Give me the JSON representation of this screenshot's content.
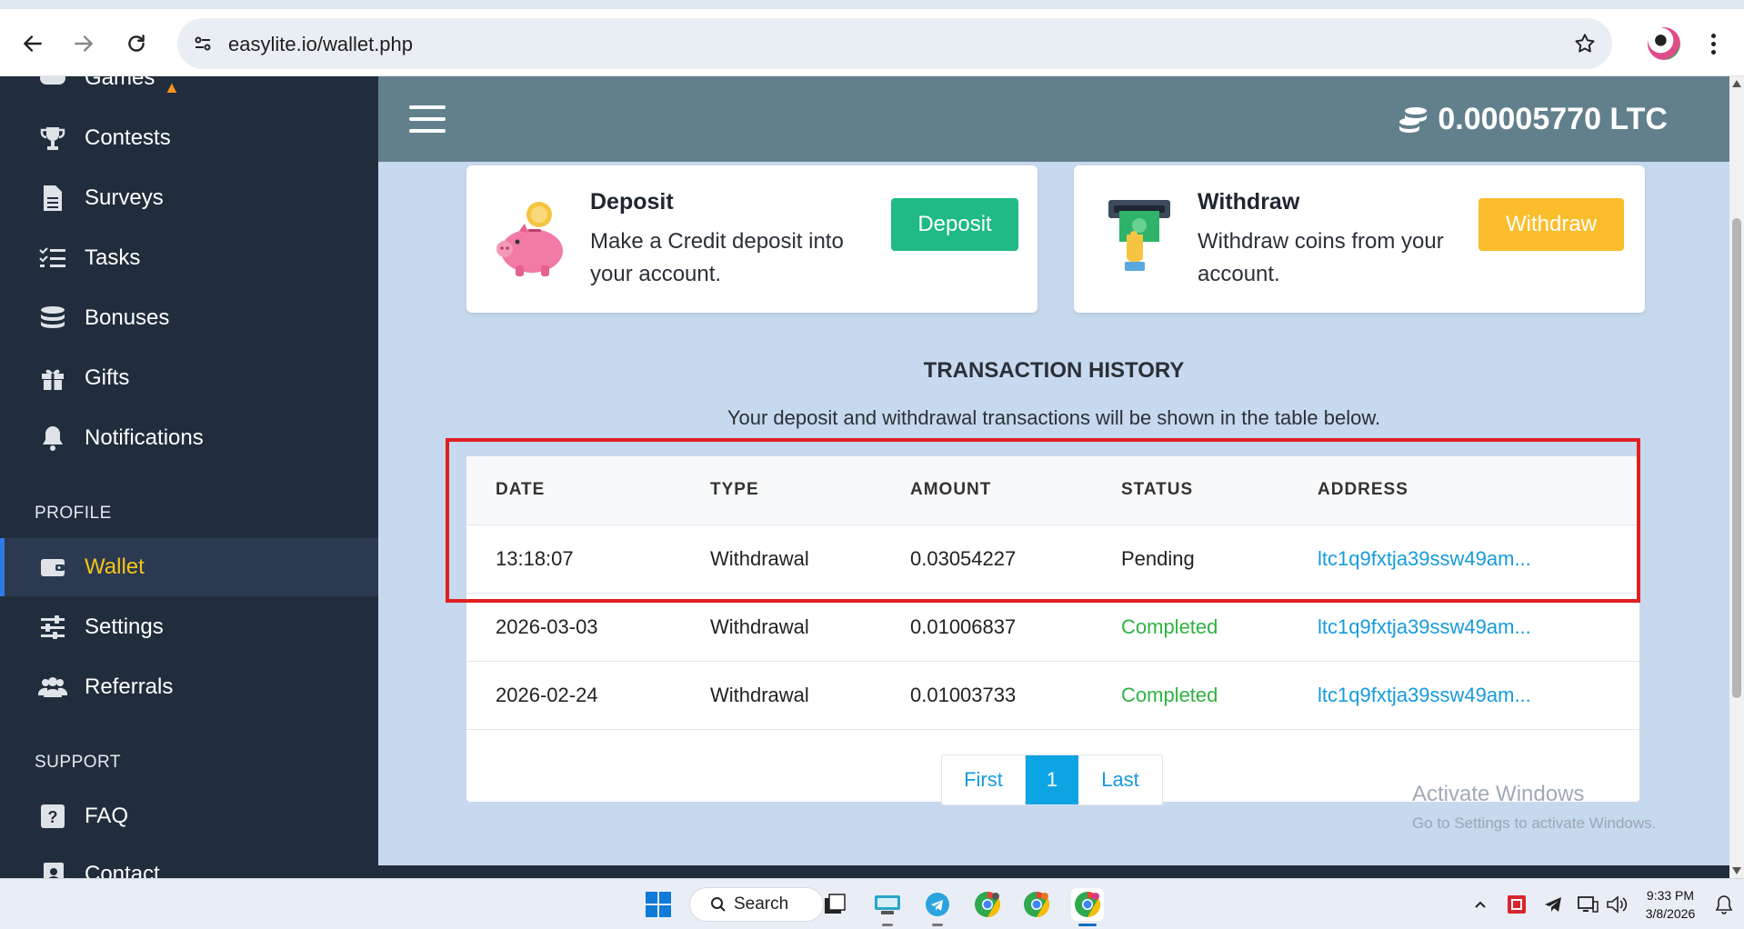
{
  "browser": {
    "url": "easylite.io/wallet.php"
  },
  "sidebar": {
    "items_top": [
      {
        "label": "Games",
        "icon": "gamepad-icon"
      },
      {
        "label": "Contests",
        "icon": "trophy-icon"
      },
      {
        "label": "Surveys",
        "icon": "document-icon"
      },
      {
        "label": "Tasks",
        "icon": "tasks-icon"
      },
      {
        "label": "Bonuses",
        "icon": "coins-icon"
      },
      {
        "label": "Gifts",
        "icon": "gift-icon"
      },
      {
        "label": "Notifications",
        "icon": "bell-icon"
      }
    ],
    "profile_section": "PROFILE",
    "profile_items": [
      {
        "label": "Wallet",
        "icon": "wallet-icon",
        "active": true
      },
      {
        "label": "Settings",
        "icon": "sliders-icon"
      },
      {
        "label": "Referrals",
        "icon": "users-icon"
      }
    ],
    "support_section": "SUPPORT",
    "support_items": [
      {
        "label": "FAQ",
        "icon": "question-icon"
      },
      {
        "label": "Contact",
        "icon": "contact-icon"
      }
    ]
  },
  "header": {
    "balance": "0.00005770 LTC"
  },
  "deposit_card": {
    "title": "Deposit",
    "description": "Make a Credit deposit into your account.",
    "button": "Deposit",
    "button_color": "#1fba86"
  },
  "withdraw_card": {
    "title": "Withdraw",
    "description": "Withdraw coins from your account.",
    "button": "Withdraw",
    "button_color": "#fbbd2c"
  },
  "history": {
    "title": "TRANSACTION HISTORY",
    "subtitle": "Your deposit and withdrawal transactions will be shown in the table below.",
    "columns": [
      "DATE",
      "TYPE",
      "AMOUNT",
      "STATUS",
      "ADDRESS"
    ],
    "rows": [
      {
        "date": "13:18:07",
        "type": "Withdrawal",
        "amount": "0.03054227",
        "status": "Pending",
        "address": "ltc1q9fxtja39ssw49am..."
      },
      {
        "date": "2026-03-03",
        "type": "Withdrawal",
        "amount": "0.01006837",
        "status": "Completed",
        "address": "ltc1q9fxtja39ssw49am..."
      },
      {
        "date": "2026-02-24",
        "type": "Withdrawal",
        "amount": "0.01003733",
        "status": "Completed",
        "address": "ltc1q9fxtja39ssw49am..."
      }
    ],
    "pager": {
      "first": "First",
      "current": "1",
      "last": "Last"
    }
  },
  "watermark": {
    "line1": "Activate Windows",
    "line2": "Go to Settings to activate Windows."
  },
  "taskbar": {
    "search": "Search",
    "time": "9:33 PM",
    "date": "3/8/2026"
  },
  "colors": {
    "sidebar_bg": "#212d3d",
    "main_bg": "#c7d9ee",
    "topbar_bg": "#62808c",
    "link": "#169bdc",
    "completed": "#2fb342",
    "highlight": "#e02020",
    "active_label": "#f5c419"
  }
}
